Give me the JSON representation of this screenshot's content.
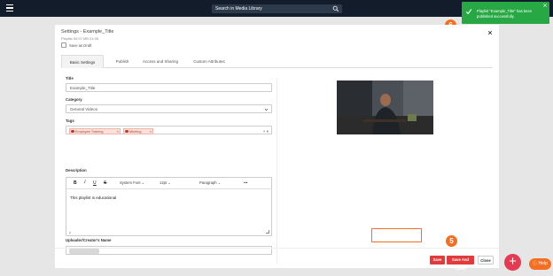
{
  "topbar": {
    "search_placeholder": "Search in Media Library"
  },
  "toast": {
    "message": "Playlist \"Example_Title\" has been published successfully."
  },
  "annotations": {
    "toast_step": "6",
    "buttons_step": "5"
  },
  "modal": {
    "title": "Settings - Example_Title",
    "subtitle": "Playlist   00:07 MB   01:05",
    "save_as_draft": "Save as Draft",
    "tabs": [
      {
        "label": "Basic Settings",
        "active": true
      },
      {
        "label": "Publish",
        "active": false
      },
      {
        "label": "Access and Sharing",
        "active": false
      },
      {
        "label": "Custom Attributes",
        "active": false
      }
    ],
    "fields": {
      "title_label": "Title",
      "title_value": "Example_Title",
      "category_label": "Category",
      "category_value": "General Videos",
      "tags_label": "Tags",
      "tags": [
        "Employee Training",
        "Meeting"
      ],
      "tags_controls": "× ▾",
      "description_label": "Description",
      "toolbar": {
        "bold": "B",
        "italic": "I",
        "underline": "U",
        "strike": "S",
        "font": "System Font",
        "size": "12pt",
        "block": "Paragraph",
        "more": "•••"
      },
      "description_text": "This playlist is educational",
      "editor_footer": "p",
      "uploader_label": "Uploader/Creator's Name"
    },
    "buttons": {
      "save": "Save",
      "save_and_close": "Save And Close",
      "close": "Close"
    }
  },
  "fab": {
    "label": "+"
  },
  "help": {
    "label": "Help",
    "icon": "question-icon"
  },
  "colors": {
    "topbar": "#121c2a",
    "toast": "#27a844",
    "accent": "#e23b3b",
    "highlight": "#f36f21"
  }
}
